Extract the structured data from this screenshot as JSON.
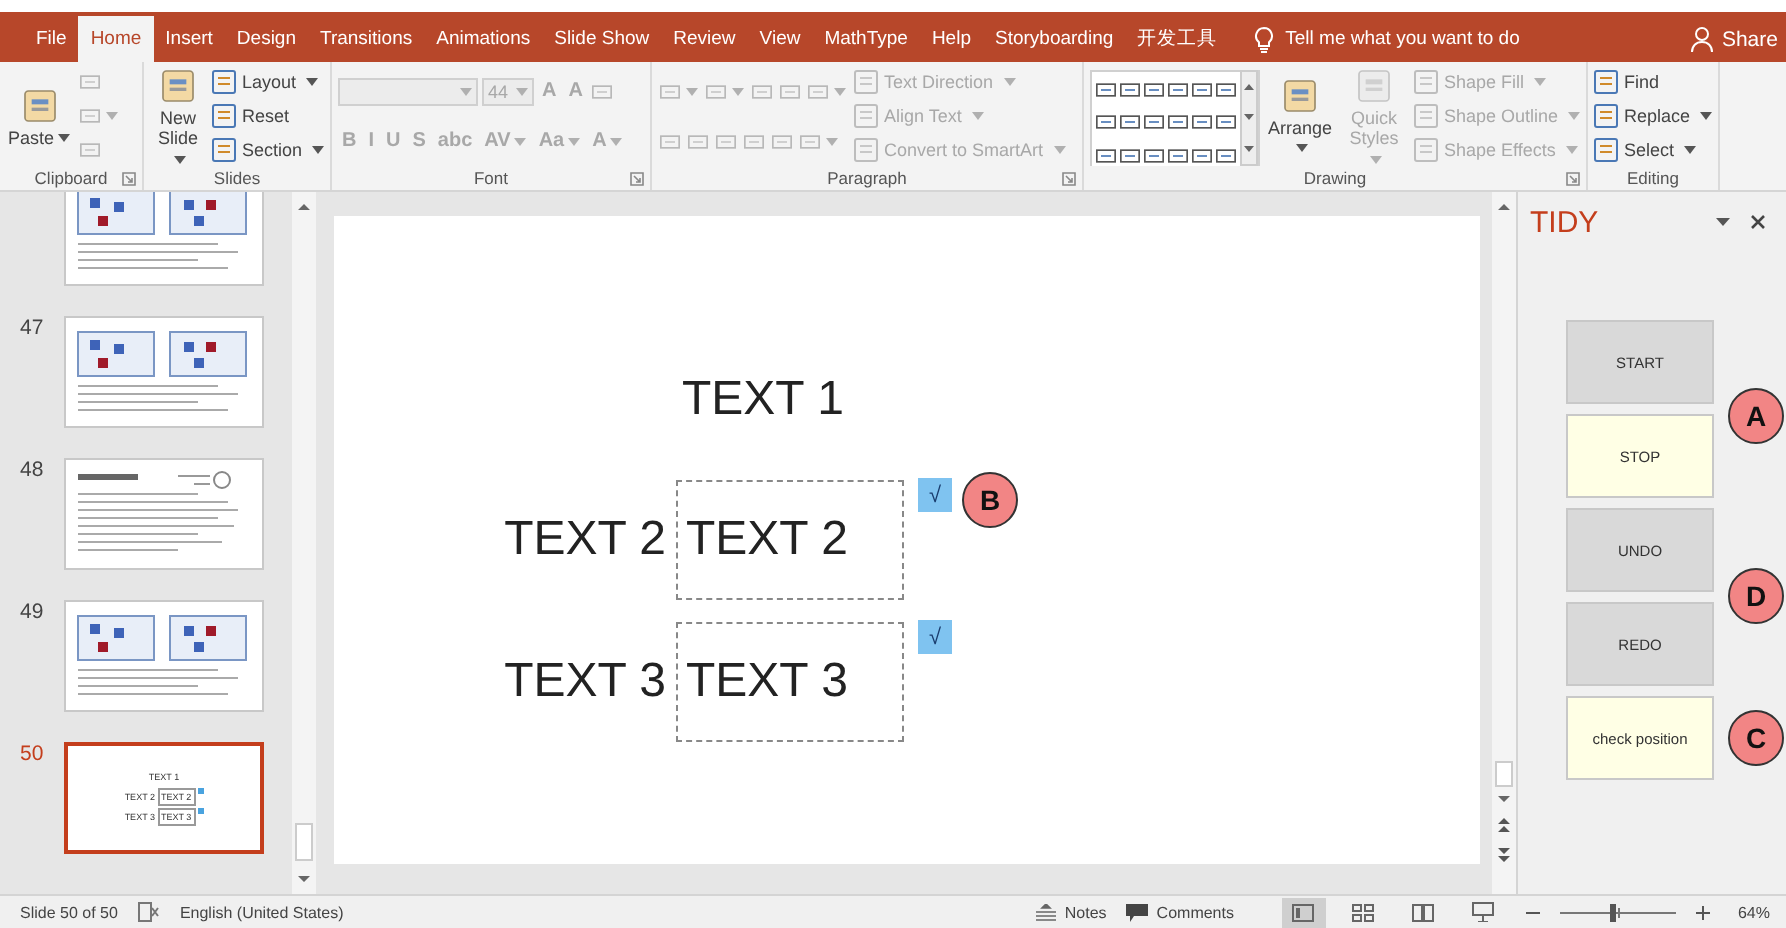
{
  "tabs": [
    {
      "label": "File",
      "selected": false
    },
    {
      "label": "Home",
      "selected": true
    },
    {
      "label": "Insert",
      "selected": false
    },
    {
      "label": "Design",
      "selected": false
    },
    {
      "label": "Transitions",
      "selected": false
    },
    {
      "label": "Animations",
      "selected": false
    },
    {
      "label": "Slide Show",
      "selected": false
    },
    {
      "label": "Review",
      "selected": false
    },
    {
      "label": "View",
      "selected": false
    },
    {
      "label": "MathType",
      "selected": false
    },
    {
      "label": "Help",
      "selected": false
    },
    {
      "label": "Storyboarding",
      "selected": false
    },
    {
      "label": "开发工具",
      "selected": false
    }
  ],
  "tell_me": "Tell me what you want to do",
  "share": "Share",
  "ribbon": {
    "groups": [
      {
        "name": "Clipboard",
        "launcher": true,
        "sections": [
          {
            "kind": "plain",
            "rows": [
              [
                {
                  "kind": "large",
                  "label": "Paste",
                  "dropdown": true,
                  "disabled": false
                }
              ]
            ]
          },
          {
            "kind": "plain",
            "rows": [
              [
                {
                  "kind": "glyph",
                  "dropdown": false,
                  "disabled": true
                }
              ],
              [
                {
                  "kind": "glyph",
                  "dropdown": true,
                  "disabled": true
                }
              ],
              [
                {
                  "kind": "glyph",
                  "dropdown": false,
                  "disabled": true
                }
              ]
            ]
          }
        ]
      },
      {
        "name": "Slides",
        "launcher": false,
        "sections": [
          {
            "kind": "plain",
            "rows": [
              [
                {
                  "kind": "large",
                  "label": "New Slide",
                  "dropdown": true,
                  "disabled": false
                }
              ]
            ]
          },
          {
            "kind": "plain",
            "rows": [
              [
                {
                  "kind": "small",
                  "label": "Layout",
                  "dropdown": true,
                  "disabled": false
                }
              ],
              [
                {
                  "kind": "small",
                  "label": "Reset",
                  "dropdown": false,
                  "disabled": false
                }
              ],
              [
                {
                  "kind": "small",
                  "label": "Section",
                  "dropdown": true,
                  "disabled": false
                }
              ]
            ]
          }
        ]
      },
      {
        "name": "Font",
        "launcher": true,
        "sections": [
          {
            "kind": "plain",
            "rows": [
              [
                {
                  "kind": "field",
                  "dropdown": true,
                  "disabled": true
                },
                {
                  "kind": "field",
                  "label": "44",
                  "dropdown": true,
                  "disabled": true
                },
                {
                  "kind": "text",
                  "label": "A",
                  "dropdown": false,
                  "disabled": true
                },
                {
                  "kind": "text",
                  "label": "A",
                  "dropdown": false,
                  "disabled": true
                },
                {
                  "kind": "glyph",
                  "dropdown": false,
                  "disabled": true
                }
              ]
            ]
          },
          {
            "kind": "plain",
            "rows": [
              [
                {
                  "kind": "text",
                  "label": "B",
                  "dropdown": false,
                  "disabled": true
                },
                {
                  "kind": "text",
                  "label": "I",
                  "dropdown": false,
                  "disabled": true
                },
                {
                  "kind": "text",
                  "label": "U",
                  "dropdown": false,
                  "disabled": true
                },
                {
                  "kind": "text",
                  "label": "S",
                  "dropdown": false,
                  "disabled": true
                },
                {
                  "kind": "text",
                  "label": "abc",
                  "dropdown": false,
                  "disabled": true
                },
                {
                  "kind": "text",
                  "label": "AV",
                  "dropdown": true,
                  "disabled": true
                },
                {
                  "kind": "text",
                  "label": "Aa",
                  "dropdown": true,
                  "disabled": true
                },
                {
                  "kind": "text",
                  "label": "A",
                  "dropdown": true,
                  "disabled": true
                }
              ]
            ]
          }
        ]
      },
      {
        "name": "Paragraph",
        "launcher": true,
        "sections": [
          {
            "kind": "plain",
            "rows": [
              [
                {
                  "kind": "glyph",
                  "dropdown": true,
                  "disabled": true
                },
                {
                  "kind": "glyph",
                  "dropdown": true,
                  "disabled": true
                },
                {
                  "kind": "glyph",
                  "dropdown": false,
                  "disabled": true
                },
                {
                  "kind": "glyph",
                  "dropdown": false,
                  "disabled": true
                },
                {
                  "kind": "glyph",
                  "dropdown": true,
                  "disabled": true
                }
              ],
              [
                {
                  "kind": "glyph",
                  "dropdown": false,
                  "disabled": true
                },
                {
                  "kind": "glyph",
                  "dropdown": false,
                  "disabled": true
                },
                {
                  "kind": "glyph",
                  "dropdown": false,
                  "disabled": true
                },
                {
                  "kind": "glyph",
                  "dropdown": false,
                  "disabled": true
                },
                {
                  "kind": "glyph",
                  "dropdown": false,
                  "disabled": true
                },
                {
                  "kind": "glyph",
                  "dropdown": true,
                  "disabled": true
                }
              ]
            ]
          },
          {
            "kind": "plain",
            "rows": [
              [
                {
                  "kind": "small",
                  "label": "Text Direction",
                  "dropdown": true,
                  "disabled": true
                }
              ],
              [
                {
                  "kind": "small",
                  "label": "Align Text",
                  "dropdown": true,
                  "disabled": true
                }
              ],
              [
                {
                  "kind": "small",
                  "label": "Convert to SmartArt",
                  "dropdown": true,
                  "disabled": true
                }
              ]
            ]
          }
        ]
      },
      {
        "name": "Drawing",
        "launcher": true,
        "sections": [
          {
            "kind": "gallery",
            "rows": [
              [
                {
                  "kind": "glyph",
                  "dropdown": false,
                  "disabled": false
                },
                {
                  "kind": "glyph",
                  "dropdown": false,
                  "disabled": false
                },
                {
                  "kind": "glyph",
                  "dropdown": false,
                  "disabled": false
                },
                {
                  "kind": "glyph",
                  "dropdown": false,
                  "disabled": false
                },
                {
                  "kind": "glyph",
                  "dropdown": false,
                  "disabled": false
                },
                {
                  "kind": "glyph",
                  "dropdown": false,
                  "disabled": false
                }
              ],
              [
                {
                  "kind": "glyph",
                  "dropdown": false,
                  "disabled": false
                },
                {
                  "kind": "glyph",
                  "dropdown": false,
                  "disabled": false
                },
                {
                  "kind": "glyph",
                  "dropdown": false,
                  "disabled": false
                },
                {
                  "kind": "glyph",
                  "dropdown": false,
                  "disabled": false
                },
                {
                  "kind": "glyph",
                  "dropdown": false,
                  "disabled": false
                },
                {
                  "kind": "glyph",
                  "dropdown": false,
                  "disabled": false
                }
              ],
              [
                {
                  "kind": "glyph",
                  "dropdown": false,
                  "disabled": false
                },
                {
                  "kind": "glyph",
                  "dropdown": false,
                  "disabled": false
                },
                {
                  "kind": "glyph",
                  "dropdown": false,
                  "disabled": false
                },
                {
                  "kind": "glyph",
                  "dropdown": false,
                  "disabled": false
                },
                {
                  "kind": "glyph",
                  "dropdown": false,
                  "disabled": false
                },
                {
                  "kind": "glyph",
                  "dropdown": false,
                  "disabled": false
                }
              ]
            ]
          },
          {
            "kind": "plain",
            "rows": [
              [
                {
                  "kind": "large",
                  "label": "Arrange",
                  "dropdown": true,
                  "disabled": false
                }
              ]
            ]
          },
          {
            "kind": "plain",
            "rows": [
              [
                {
                  "kind": "large",
                  "label": "Quick Styles",
                  "dropdown": true,
                  "disabled": true
                }
              ]
            ]
          },
          {
            "kind": "plain",
            "rows": [
              [
                {
                  "kind": "small",
                  "label": "Shape Fill",
                  "dropdown": true,
                  "disabled": true
                }
              ],
              [
                {
                  "kind": "small",
                  "label": "Shape Outline",
                  "dropdown": true,
                  "disabled": true
                }
              ],
              [
                {
                  "kind": "small",
                  "label": "Shape Effects",
                  "dropdown": true,
                  "disabled": true
                }
              ]
            ]
          }
        ]
      },
      {
        "name": "Editing",
        "launcher": false,
        "sections": [
          {
            "kind": "plain",
            "rows": [
              [
                {
                  "kind": "small",
                  "label": "Find",
                  "dropdown": false,
                  "disabled": false
                }
              ],
              [
                {
                  "kind": "small",
                  "label": "Replace",
                  "dropdown": true,
                  "disabled": false
                }
              ],
              [
                {
                  "kind": "small",
                  "label": "Select",
                  "dropdown": true,
                  "disabled": false
                }
              ]
            ]
          }
        ]
      }
    ]
  },
  "thumbnails": [
    {
      "kind": "two_panels",
      "selected": false
    },
    {
      "number": "47",
      "kind": "two_panels",
      "selected": false
    },
    {
      "number": "48",
      "kind": "text",
      "selected": false
    },
    {
      "number": "49",
      "kind": "two_panels",
      "selected": false
    },
    {
      "number": "50",
      "kind": "mini_slide",
      "selected": true,
      "texts": [
        "TEXT 1",
        "TEXT 2",
        "TEXT 2",
        "TEXT 3",
        "TEXT 3"
      ]
    }
  ],
  "slide": {
    "title": "TEXT 1",
    "rows": [
      {
        "label": "TEXT 2",
        "box_text": "TEXT 2",
        "check": "√",
        "callout": "B"
      },
      {
        "label": "TEXT 3",
        "box_text": "TEXT 3",
        "check": "√"
      }
    ]
  },
  "pane": {
    "title": "TIDY",
    "buttons": [
      {
        "label": "START",
        "color": "#d9d9d9"
      },
      {
        "label": "STOP",
        "color": "#ffffe5"
      },
      {
        "label": "UNDO",
        "color": "#d9d9d9"
      },
      {
        "label": "REDO",
        "color": "#d9d9d9"
      },
      {
        "label": "check position",
        "color": "#ffffe5"
      }
    ],
    "callouts": [
      "A",
      "D",
      "C"
    ]
  },
  "status": {
    "slide": "Slide 50 of 50",
    "language": "English (United States)",
    "notes": "Notes",
    "comments": "Comments",
    "views": [
      {
        "kind": "normal",
        "selected": true
      },
      {
        "kind": "sorter",
        "selected": false
      },
      {
        "kind": "reading",
        "selected": false
      },
      {
        "kind": "slideshow",
        "selected": false
      }
    ],
    "zoom": {
      "level": 0.45,
      "reading": "64%"
    }
  }
}
